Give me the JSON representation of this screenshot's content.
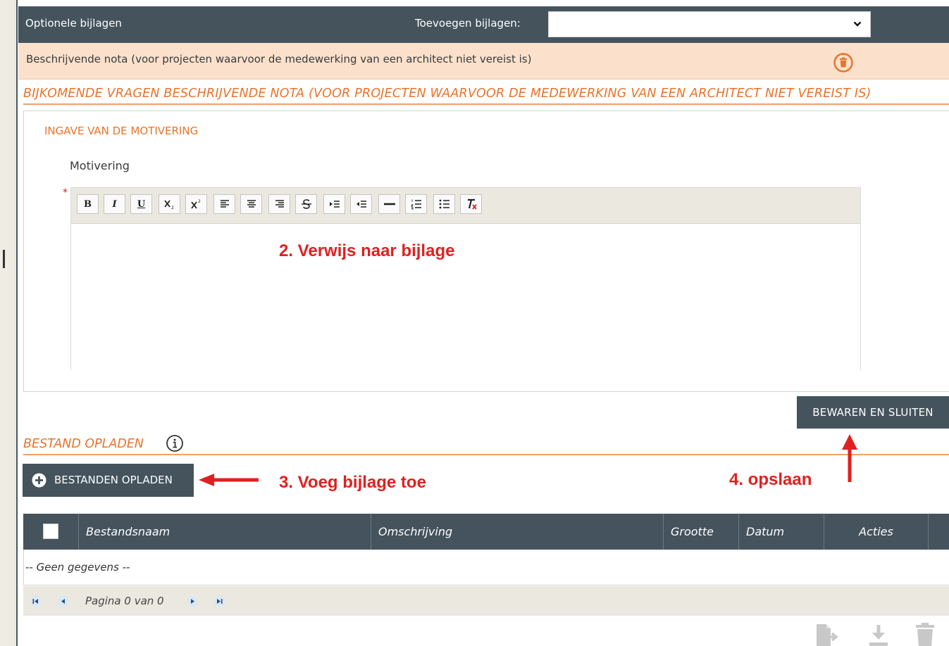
{
  "header": {
    "title": "Optionele bijlagen",
    "add_label": "Toevoegen bijlagen:",
    "select_value": ""
  },
  "attachment": {
    "label": "Beschrijvende nota (voor projecten waarvoor de medewerking van een architect niet vereist is)"
  },
  "section": {
    "heading": "BIJKOMENDE VRAGEN BESCHRIJVENDE NOTA (VOOR PROJECTEN WAARVOOR DE MEDEWERKING VAN EEN ARCHITECT NIET VEREIST IS)"
  },
  "panel": {
    "title": "INGAVE VAN DE MOTIVERING",
    "field_label": "Motivering",
    "required_mark": "*",
    "editor_content": ""
  },
  "toolbar": {
    "bold": "B",
    "italic": "I",
    "underline": "U"
  },
  "annotations": {
    "step2": "2. Verwijs naar bijlage",
    "step3": "3. Voeg bijlage toe",
    "step4": "4. opslaan"
  },
  "buttons": {
    "save": "BEWAREN EN SLUITEN",
    "upload": "BESTANDEN OPLADEN"
  },
  "upload": {
    "heading": "BESTAND OPLADEN"
  },
  "table": {
    "columns": [
      "Bestandsnaam",
      "Omschrijving",
      "Grootte",
      "Datum",
      "Acties"
    ],
    "empty": "-- Geen gegevens --"
  },
  "pager": {
    "text": "Pagina 0 van 0"
  },
  "colors": {
    "dark_bar": "#44535c",
    "accent_orange": "#e8742b",
    "row_peach": "#fbe1cc",
    "annotation_red": "#e02020"
  }
}
